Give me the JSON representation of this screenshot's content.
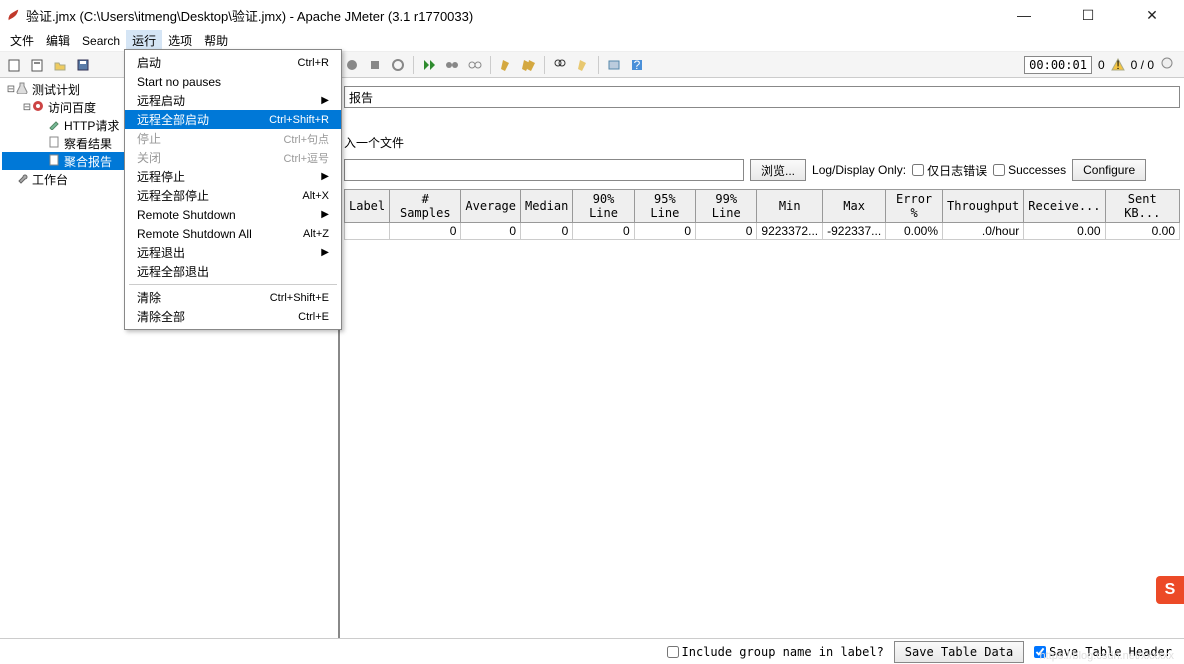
{
  "window": {
    "title": "验证.jmx (C:\\Users\\itmeng\\Desktop\\验证.jmx) - Apache JMeter (3.1 r1770033)",
    "min": "—",
    "max": "☐",
    "close": "✕"
  },
  "menu": {
    "items": [
      "文件",
      "编辑",
      "Search",
      "运行",
      "选项",
      "帮助"
    ],
    "open_index": 3
  },
  "dropdown": {
    "sections": [
      [
        {
          "label": "启动",
          "shortcut": "Ctrl+R",
          "state": "n"
        },
        {
          "label": "Start no pauses",
          "shortcut": "",
          "state": "n"
        },
        {
          "label": "远程启动",
          "shortcut": "",
          "state": "sub"
        },
        {
          "label": "远程全部启动",
          "shortcut": "Ctrl+Shift+R",
          "state": "hl"
        },
        {
          "label": "停止",
          "shortcut": "Ctrl+句点",
          "state": "dis"
        },
        {
          "label": "关闭",
          "shortcut": "Ctrl+逗号",
          "state": "dis"
        },
        {
          "label": "远程停止",
          "shortcut": "",
          "state": "sub"
        },
        {
          "label": "远程全部停止",
          "shortcut": "Alt+X",
          "state": "n"
        },
        {
          "label": "Remote Shutdown",
          "shortcut": "",
          "state": "sub"
        },
        {
          "label": "Remote Shutdown All",
          "shortcut": "Alt+Z",
          "state": "n"
        },
        {
          "label": "远程退出",
          "shortcut": "",
          "state": "sub"
        },
        {
          "label": "远程全部退出",
          "shortcut": "",
          "state": "n"
        }
      ],
      [
        {
          "label": "清除",
          "shortcut": "Ctrl+Shift+E",
          "state": "n"
        },
        {
          "label": "清除全部",
          "shortcut": "Ctrl+E",
          "state": "n"
        }
      ]
    ]
  },
  "tree": {
    "nodes": [
      {
        "indent": 0,
        "exp": "⊟",
        "label": "测试计划",
        "icon": "flask"
      },
      {
        "indent": 1,
        "exp": "⊟",
        "label": "访问百度",
        "icon": "gear-red"
      },
      {
        "indent": 2,
        "exp": "",
        "label": "HTTP请求",
        "icon": "pipette"
      },
      {
        "indent": 2,
        "exp": "",
        "label": "察看结果",
        "icon": "page"
      },
      {
        "indent": 2,
        "exp": "",
        "label": "聚合报告",
        "icon": "page",
        "sel": true
      },
      {
        "indent": 0,
        "exp": "",
        "label": "工作台",
        "icon": "wrench"
      }
    ]
  },
  "panel": {
    "name_value": "报告",
    "file_prefix": "入一个文件",
    "browse": "浏览...",
    "logdisplay": "Log/Display Only:",
    "ck_errors": "仅日志错误",
    "ck_success": "Successes",
    "configure": "Configure"
  },
  "table": {
    "headers": [
      "Label",
      "# Samples",
      "Average",
      "Median",
      "90% Line",
      "95% Line",
      "99% Line",
      "Min",
      "Max",
      "Error %",
      "Throughput",
      "Receive...",
      "Sent KB..."
    ],
    "row": [
      "",
      "0",
      "0",
      "0",
      "0",
      "0",
      "0",
      "9223372...",
      "-922337...",
      "0.00%",
      ".0/hour",
      "0.00",
      "0.00"
    ]
  },
  "bottom": {
    "include": "Include group name in label?",
    "savedata": "Save Table Data",
    "saveheader": "Save Table Header"
  },
  "status": {
    "timer": "00:00:01",
    "warn": "0",
    "threads": "0 / 0"
  },
  "watermark": "https://blog.csdn.net/xxxxxx"
}
